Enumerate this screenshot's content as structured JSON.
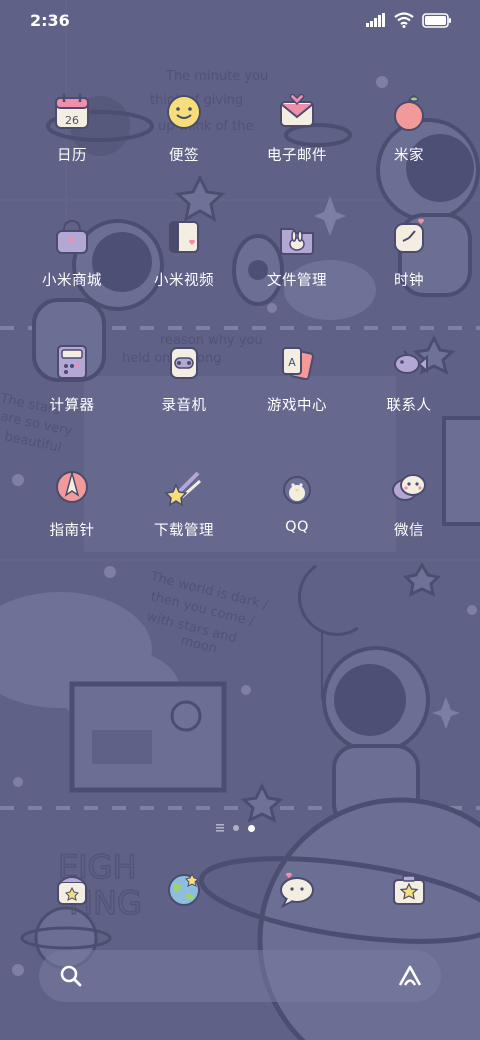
{
  "status_bar": {
    "time": "2:36",
    "icons": [
      "signal-icon",
      "wifi-icon",
      "battery-icon"
    ]
  },
  "wallpaper": {
    "texts": [
      "The minute you",
      "think of giving",
      "up think of the",
      "reason why you",
      "held on so long",
      "The stars",
      "are so very",
      "beautiful",
      "The world is dark /",
      "then you come /",
      "with stars  and",
      "moon",
      "EIGH",
      "TING"
    ],
    "background_color": "#5f6286"
  },
  "apps": [
    {
      "label": "日历",
      "icon": "calendar-icon",
      "date": "26"
    },
    {
      "label": "便签",
      "icon": "notes-icon"
    },
    {
      "label": "电子邮件",
      "icon": "email-icon"
    },
    {
      "label": "米家",
      "icon": "mijia-apple-icon"
    },
    {
      "label": "小米商城",
      "icon": "mi-store-bag-icon"
    },
    {
      "label": "小米视频",
      "icon": "mi-video-icon"
    },
    {
      "label": "文件管理",
      "icon": "file-manager-icon"
    },
    {
      "label": "时钟",
      "icon": "clock-icon"
    },
    {
      "label": "计算器",
      "icon": "calculator-icon"
    },
    {
      "label": "录音机",
      "icon": "recorder-icon"
    },
    {
      "label": "游戏中心",
      "icon": "game-center-cards-icon"
    },
    {
      "label": "联系人",
      "icon": "contacts-fish-icon"
    },
    {
      "label": "指南针",
      "icon": "compass-icon"
    },
    {
      "label": "下载管理",
      "icon": "download-star-icon"
    },
    {
      "label": "QQ",
      "icon": "qq-penguin-icon"
    },
    {
      "label": "微信",
      "icon": "wechat-bubble-icon"
    }
  ],
  "page_indicator": {
    "pages": 2,
    "current": 2
  },
  "dock": [
    {
      "icon": "phone-icon"
    },
    {
      "icon": "browser-globe-icon"
    },
    {
      "icon": "messages-bubble-icon"
    },
    {
      "icon": "camera-star-icon"
    }
  ],
  "search_bar": {
    "left_icon": "search-icon",
    "right_icon": "assistant-icon"
  },
  "colors": {
    "accent_pink": "#f08fa8",
    "icon_cream": "#f4eee2",
    "icon_outline": "#4b4b6e",
    "wallpaper": "#5f6286"
  }
}
